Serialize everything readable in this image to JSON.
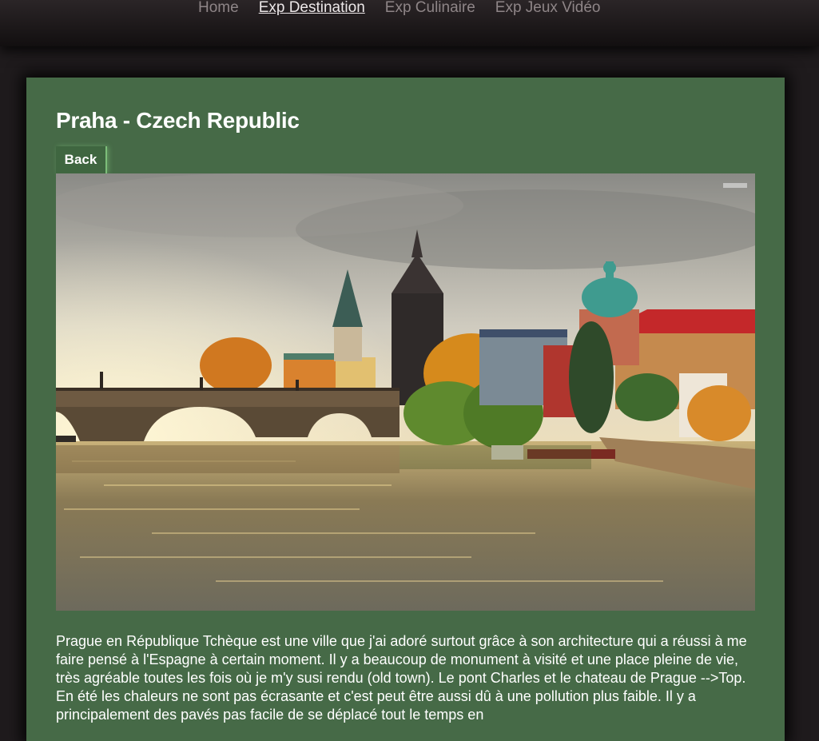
{
  "nav": {
    "items": [
      {
        "label": "Home"
      },
      {
        "label": "Exp Destination"
      },
      {
        "label": "Exp Culinaire"
      },
      {
        "label": "Exp Jeux Vidéo"
      }
    ]
  },
  "destination": {
    "title": "Praha - Czech Republic",
    "back_label": "Back",
    "photo_name": "prague-charles-bridge-photo",
    "description": "Prague en République Tchèque est une ville que j'ai adoré surtout grâce à son architecture qui a réussi à me faire pensé à l'Espagne à certain moment. Il y a beaucoup de monument à visité et une place pleine de vie, très agréable toutes les fois où je m'y susi rendu (old town). Le pont Charles et le chateau de Prague -->Top. En été les chaleurs ne sont pas écrasante et c'est peut être aussi dû à une pollution plus faible. Il y a principalement des pavés pas facile de se déplacé tout le temps en"
  },
  "colors": {
    "page_bg": "#1f1b1d",
    "card_bg": "#466a47",
    "nav_text": "#8e8587",
    "nav_active": "#ece7e8"
  }
}
